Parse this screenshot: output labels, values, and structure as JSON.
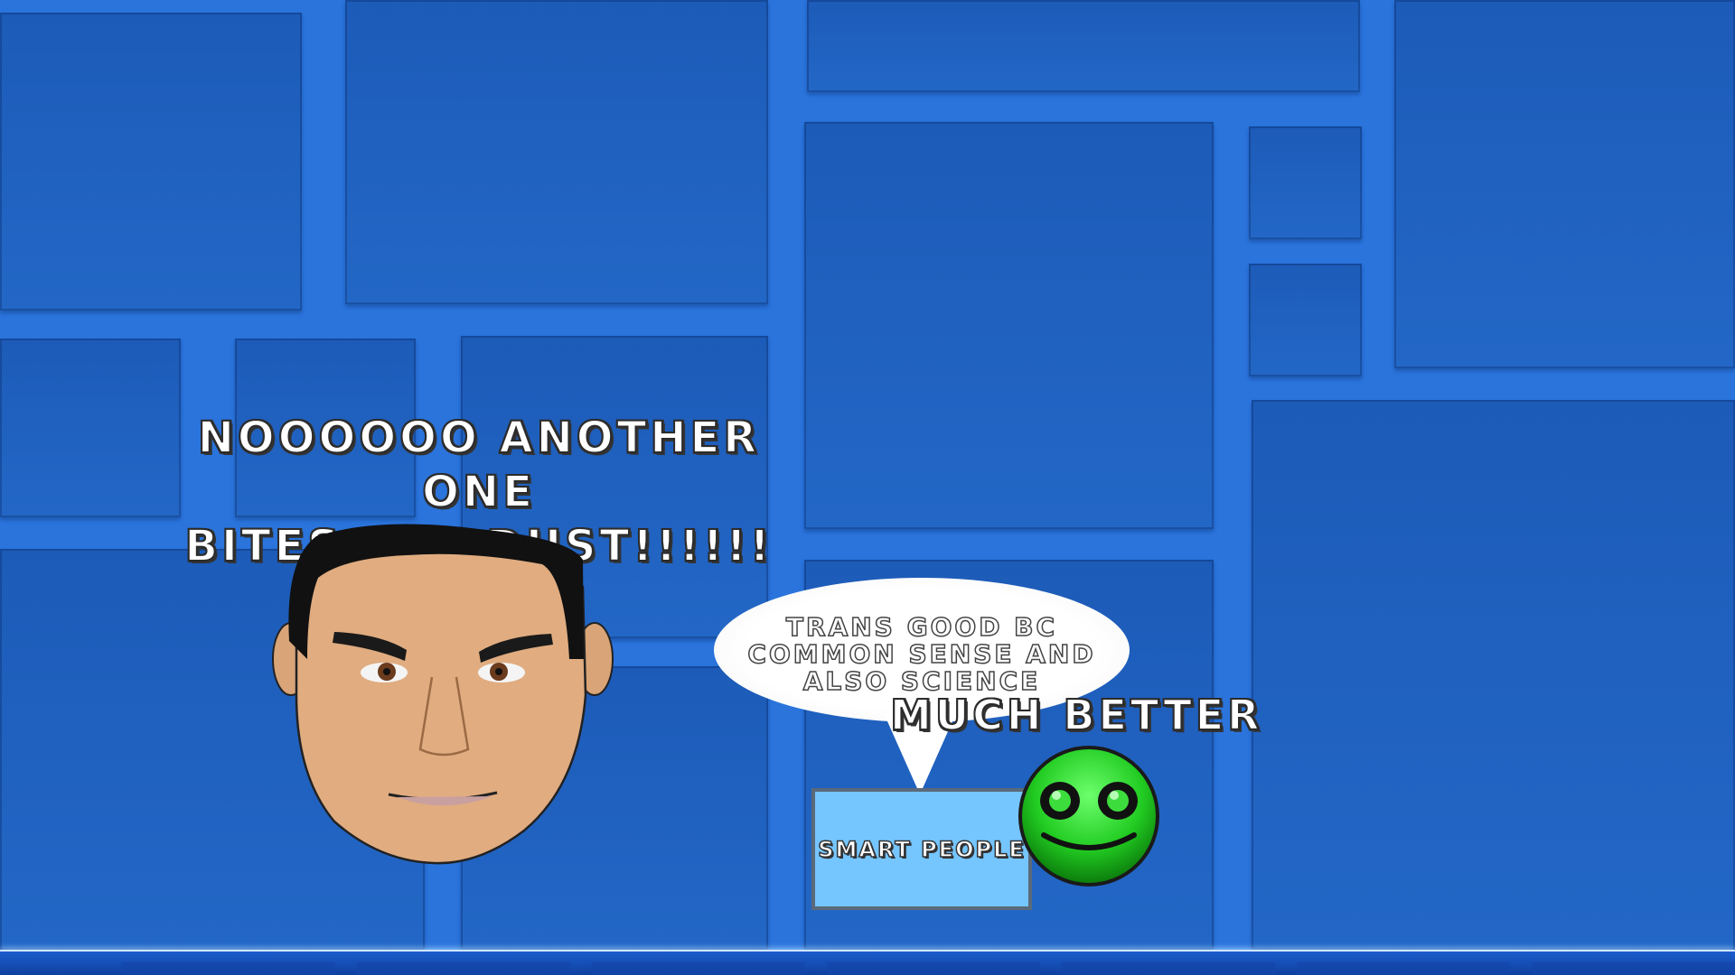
{
  "scene": {
    "background_color": "#2a74dc",
    "tile_color": "#2064c4",
    "ground_color": "#1c5ccc"
  },
  "captions": {
    "top": "NOOOOOO ANOTHER ONE\nBITES THE DUST!!!!!!",
    "green_cube": "MUCH BETTER"
  },
  "speech_bubble": {
    "text": "TRANS GOOD BC\nCOMMON SENSE AND\nALSO SCIENCE"
  },
  "box": {
    "label": "SMART PEOPLE",
    "color": "#75c5ff"
  },
  "characters": {
    "face": "cartoon-man-face",
    "cube": "green-smiley-cube-icon",
    "cube_color": "#22cc22"
  }
}
